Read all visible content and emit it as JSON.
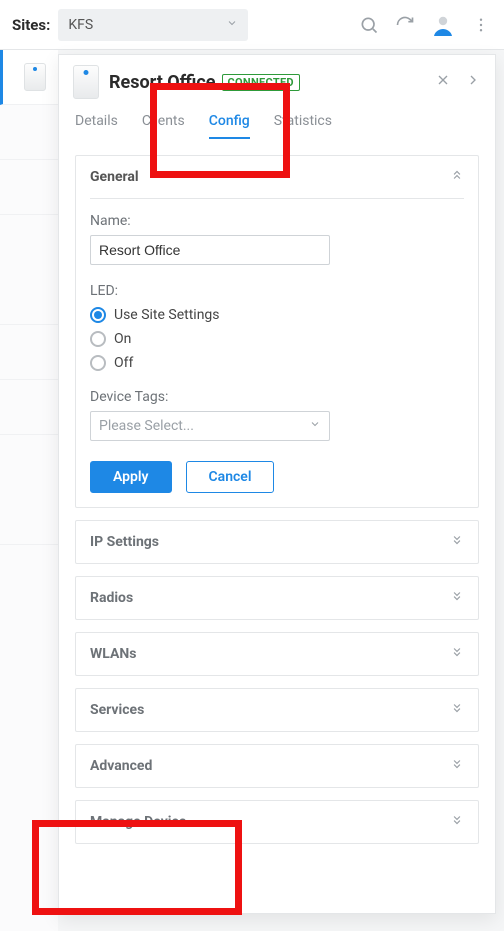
{
  "topbar": {
    "sites_label": "Sites:",
    "site_value": "KFS"
  },
  "panel": {
    "title": "Resort Office",
    "status": "CONNECTED"
  },
  "tabs": {
    "details": "Details",
    "clients": "Clients",
    "config": "Config",
    "statistics": "Statistics"
  },
  "general": {
    "section": "General",
    "name_label": "Name:",
    "name_value": "Resort Office",
    "led_label": "LED:",
    "led_opts": {
      "site": "Use Site Settings",
      "on": "On",
      "off": "Off"
    },
    "tags_label": "Device Tags:",
    "tags_placeholder": "Please Select...",
    "apply": "Apply",
    "cancel": "Cancel"
  },
  "sections": {
    "ip": "IP Settings",
    "radios": "Radios",
    "wlans": "WLANs",
    "services": "Services",
    "advanced": "Advanced",
    "manage": "Manage Device"
  }
}
